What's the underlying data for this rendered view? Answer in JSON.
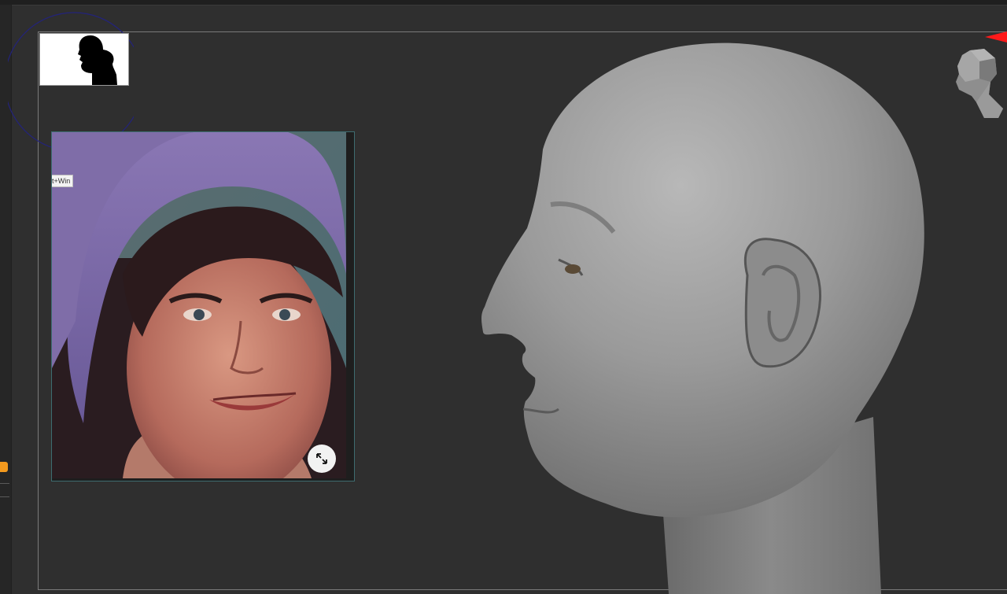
{
  "tooltip": {
    "text": "t+Win"
  },
  "icons": {
    "silhouette": "head-silhouette-icon",
    "expand": "expand-arrows-icon",
    "navigation_cube": "head-navigation-cube-icon",
    "camera_marker": "red-camera-marker-icon"
  },
  "colors": {
    "background": "#2f2f2f",
    "accent_orange": "#f39a1e",
    "ring_blue": "#2a2a8a",
    "panel_border": "#3e6c70",
    "marker_red": "#ff1a1a"
  }
}
